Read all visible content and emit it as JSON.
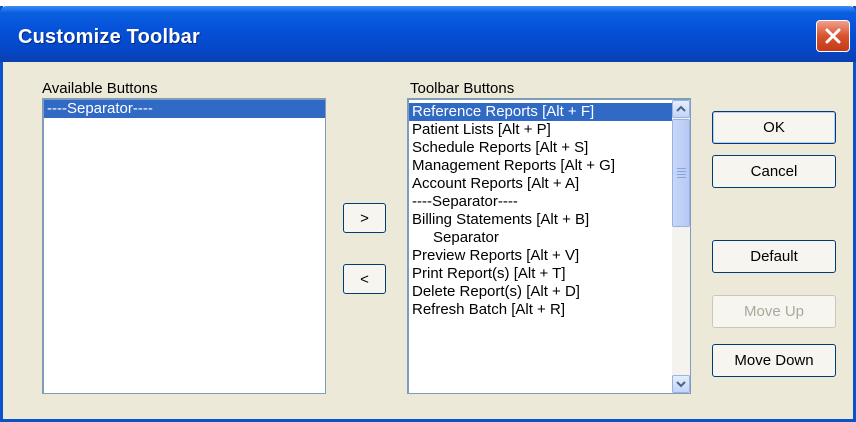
{
  "window": {
    "title": "Customize Toolbar"
  },
  "available": {
    "label": "Available Buttons",
    "items": [
      {
        "label": "----Separator----",
        "selected": true
      }
    ]
  },
  "toolbar": {
    "label": "Toolbar Buttons",
    "items": [
      {
        "label": "Reference Reports [Alt + F]",
        "selected": true
      },
      {
        "label": "Patient Lists [Alt + P]"
      },
      {
        "label": "Schedule Reports [Alt + S]"
      },
      {
        "label": "Management Reports [Alt + G]"
      },
      {
        "label": "Account Reports [Alt + A]"
      },
      {
        "label": "----Separator----"
      },
      {
        "label": "Billing Statements [Alt + B]"
      },
      {
        "label": "Separator",
        "indent": true
      },
      {
        "label": "Preview Reports [Alt + V]"
      },
      {
        "label": "Print Report(s) [Alt + T]"
      },
      {
        "label": "Delete Report(s) [Alt + D]"
      },
      {
        "label": "Refresh Batch [Alt + R]"
      }
    ]
  },
  "buttons": {
    "add": ">",
    "remove": "<",
    "ok": "OK",
    "cancel": "Cancel",
    "default": "Default",
    "move_up": "Move Up",
    "move_down": "Move Down"
  }
}
